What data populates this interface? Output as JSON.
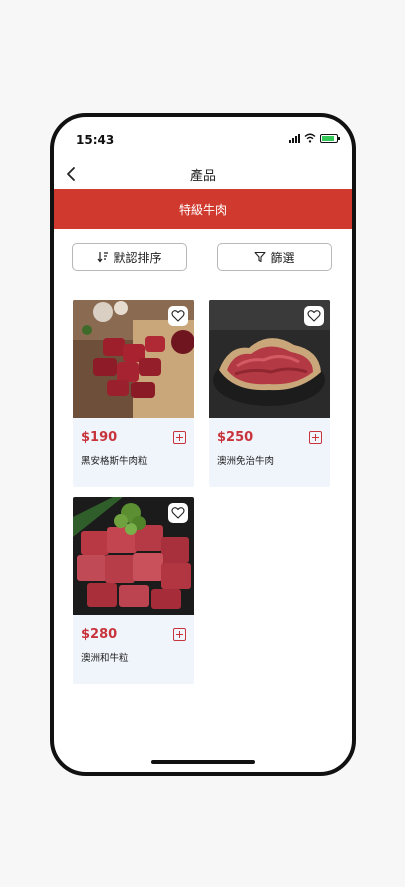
{
  "status_bar": {
    "time": "15:43"
  },
  "nav": {
    "title": "產品",
    "back_icon": "chevron-left-icon"
  },
  "category": {
    "title": "特級牛肉"
  },
  "toolbar": {
    "sort_label": "默認排序",
    "sort_icon": "sort-down-icon",
    "filter_label": "篩選",
    "filter_icon": "funnel-icon"
  },
  "colors": {
    "accent": "#d03a2e",
    "price": "#c8343c",
    "card_bg": "#f0f5fc"
  },
  "products": [
    {
      "price": "$190",
      "name": "黑安格斯牛肉粒"
    },
    {
      "price": "$250",
      "name": "澳洲免治牛肉"
    },
    {
      "price": "$280",
      "name": "澳洲和牛粒"
    }
  ]
}
